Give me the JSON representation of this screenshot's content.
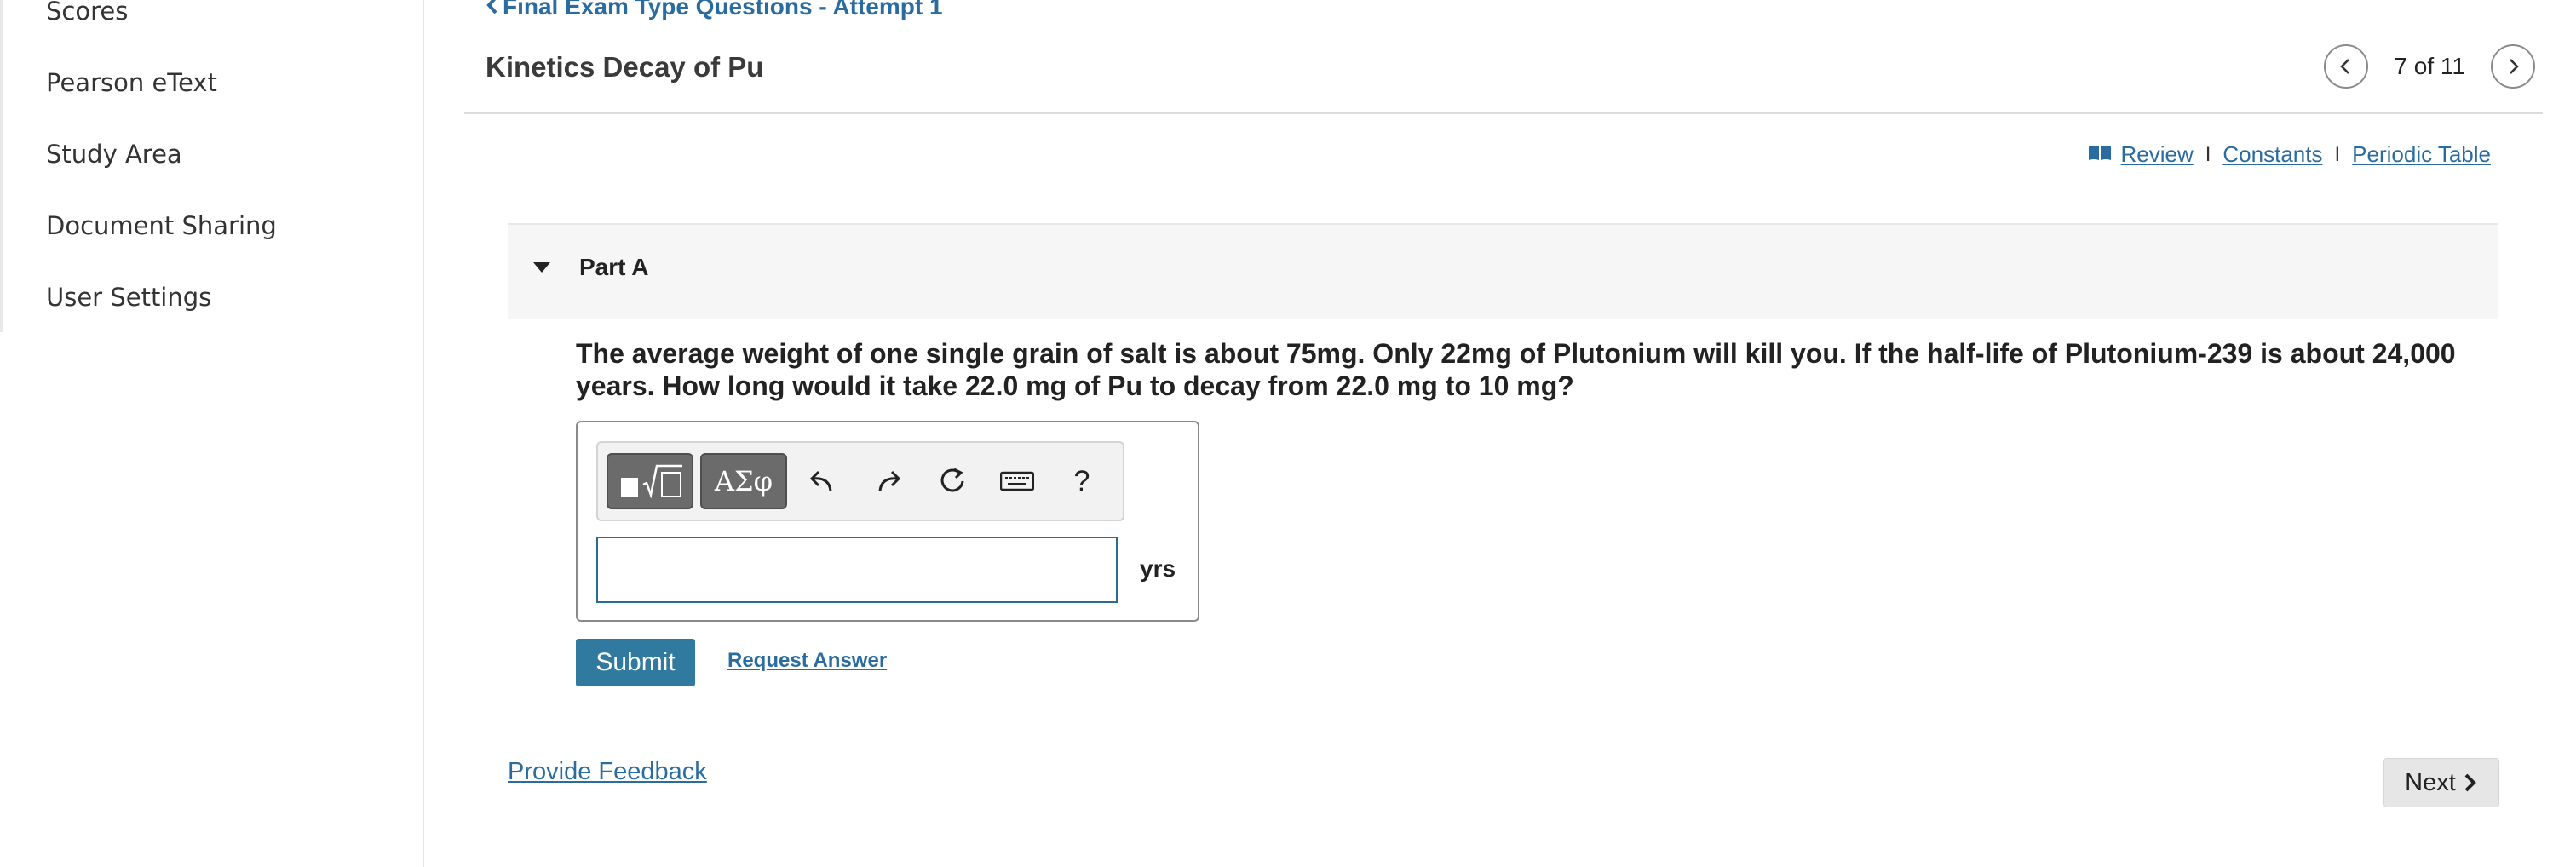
{
  "sidebar": {
    "items": [
      {
        "label": "Scores"
      },
      {
        "label": "Pearson eText"
      },
      {
        "label": "Study Area"
      },
      {
        "label": "Document Sharing"
      },
      {
        "label": "User Settings"
      }
    ]
  },
  "header": {
    "breadcrumb": "Final Exam Type Questions - Attempt 1",
    "title": "Kinetics Decay of Pu",
    "pager": "7 of 11"
  },
  "resources": {
    "review": "Review",
    "constants": "Constants",
    "periodic_table": "Periodic Table",
    "separator": "I"
  },
  "part": {
    "label": "Part A",
    "question": "The average weight of one single grain of salt is about 75mg.  Only 22mg of Plutonium will kill you.  If the half-life of Plutonium-239  is about 24,000 years.  How long would it take 22.0 mg of Pu to decay from 22.0 mg to 10  mg?"
  },
  "answer": {
    "toolbar": {
      "templates_icon": "templates-icon",
      "greek_label": "ΑΣφ",
      "undo_icon": "undo-icon",
      "redo_icon": "redo-icon",
      "reset_icon": "reset-icon",
      "keyboard_icon": "keyboard-icon",
      "help_label": "?"
    },
    "value": "",
    "unit": "yrs"
  },
  "actions": {
    "submit": "Submit",
    "request_answer": "Request Answer",
    "provide_feedback": "Provide Feedback",
    "next": "Next"
  },
  "colors": {
    "link": "#2a6ca0",
    "submit_bg": "#2f7a9e",
    "input_border": "#2a6c8f"
  }
}
